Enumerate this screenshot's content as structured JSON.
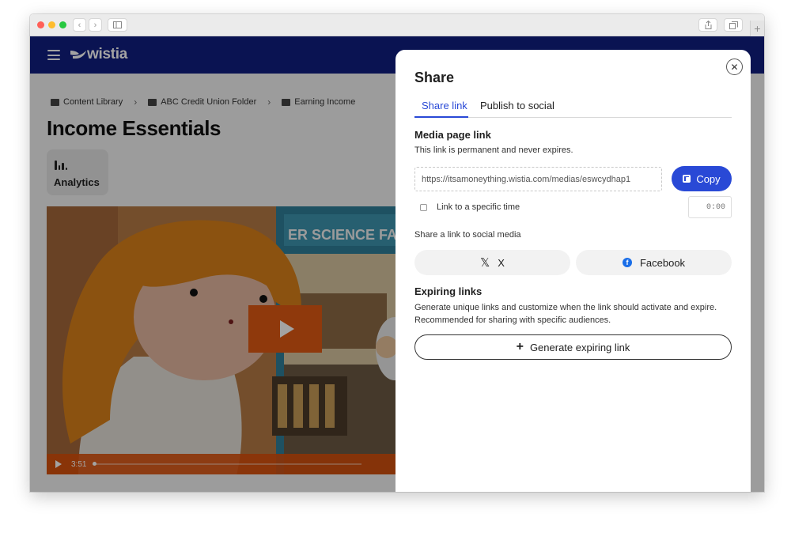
{
  "browser": {
    "traffic_lights": {
      "close": "#ff5f57",
      "minimize": "#febc2e",
      "zoom": "#28c840"
    },
    "new_tab_label": "+"
  },
  "app": {
    "brand": "wistia",
    "brand_color": "#101f80",
    "accent_color": "#2949d6"
  },
  "breadcrumb": [
    {
      "label": "Content Library",
      "icon": "library-icon"
    },
    {
      "label": "ABC Credit Union Folder",
      "icon": "folder-icon"
    },
    {
      "label": "Earning Income",
      "icon": "folder-icon"
    }
  ],
  "page": {
    "title": "Income Essentials",
    "analytics_label": "Analytics"
  },
  "video": {
    "duration": "3:51",
    "overlay_color": "#e05a13"
  },
  "share_panel": {
    "title": "Share",
    "tabs": [
      {
        "label": "Share link",
        "active": true
      },
      {
        "label": "Publish to social",
        "active": false
      }
    ],
    "media_link": {
      "heading": "Media page link",
      "description": "This link is permanent and never expires.",
      "url": "https://itsamoneything.wistia.com/medias/eswcydhap1",
      "copy_label": "Copy",
      "specific_time_label": "Link to a specific time",
      "specific_time_checked": false,
      "time_value": "0:00"
    },
    "social": {
      "heading": "Share a link to social media",
      "buttons": [
        {
          "label": "X",
          "icon": "x-logo-icon"
        },
        {
          "label": "Facebook",
          "icon": "facebook-icon"
        }
      ]
    },
    "expiring": {
      "heading": "Expiring links",
      "description_line1": "Generate unique links and customize when the link should activate and expire.",
      "description_line2": "Recommended for sharing with specific audiences.",
      "button_label": "Generate expiring link"
    }
  }
}
